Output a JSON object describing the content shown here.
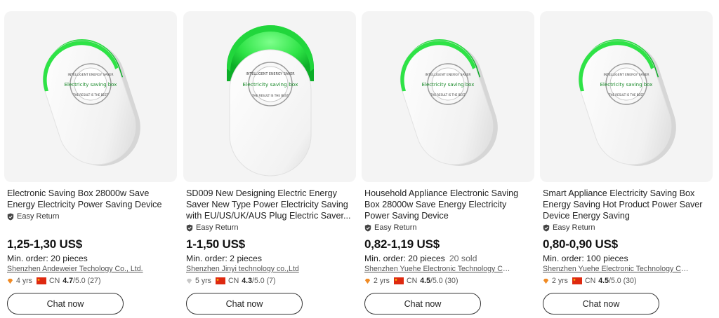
{
  "products": [
    {
      "title": "Electronic Saving Box 28000w Save Energy Electricity Power Saving Device",
      "easy_return": "Easy Return",
      "price": "1,25-1,30 US$",
      "min_order": "Min. order: 20 pieces",
      "sold": "",
      "supplier": "Shenzhen Andeweier Techology Co., Ltd.",
      "years": "4 yrs",
      "country": "CN",
      "rating_score": "4.7",
      "rating_rest": "/5.0 (27)",
      "chat_label": "Chat now",
      "badge_icon": "orange-diamond-icon",
      "device_label_top": "INTELLIGENT ENERGY SAVER",
      "device_label_main": "Electricity saving box",
      "device_label_bottom": "THE RESULT IS THE BEST"
    },
    {
      "title": "SD009 New Designing Electric Energy Saver New Type Power Electricity Saving with EU/US/UK/AUS Plug Electric Saver...",
      "easy_return": "Easy Return",
      "price": "1-1,50 US$",
      "min_order": "Min. order: 2 pieces",
      "sold": "",
      "supplier": "Shenzhen Jinyi technology co.,Ltd",
      "years": "5 yrs",
      "country": "CN",
      "rating_score": "4.3",
      "rating_rest": "/5.0 (7)",
      "chat_label": "Chat now",
      "badge_icon": "grey-diamond-icon",
      "device_label_top": "INTELLIGENT ENERGY SAVER",
      "device_label_main": "Electricity saving box",
      "device_label_bottom": "THE RESULT IS THE BEST"
    },
    {
      "title": "Household Appliance Electronic Saving Box 28000w Save Energy Electricity Power Saving Device",
      "easy_return": "Easy Return",
      "price": "0,82-1,19 US$",
      "min_order": "Min. order: 20 pieces",
      "sold": "20 sold",
      "supplier": "Shenzhen Yuehe Electronic Technology Co.,...",
      "years": "2 yrs",
      "country": "CN",
      "rating_score": "4.5",
      "rating_rest": "/5.0 (30)",
      "chat_label": "Chat now",
      "badge_icon": "orange-diamond-icon",
      "device_label_top": "INTELLIGENT ENERGY SAVER",
      "device_label_main": "Electricity saving box",
      "device_label_bottom": "THE RESULT IS THE BEST"
    },
    {
      "title": "Smart Appliance Electricity Saving Box Energy Saving Hot Product Power Saver Device Energy Saving",
      "easy_return": "Easy Return",
      "price": "0,80-0,90 US$",
      "min_order": "Min. order: 100 pieces",
      "sold": "",
      "supplier": "Shenzhen Yuehe Electronic Technology Co.,...",
      "years": "2 yrs",
      "country": "CN",
      "rating_score": "4.5",
      "rating_rest": "/5.0 (30)",
      "chat_label": "Chat now",
      "badge_icon": "orange-diamond-icon",
      "device_label_top": "INTELLIGENT ENERGY SAVER",
      "device_label_main": "Electricity saving box",
      "device_label_bottom": "THE RESULT IS THE BEST"
    }
  ],
  "colors": {
    "accent_green": "#27d83f",
    "badge_orange": "#f08a24",
    "badge_grey": "#c8c8c8",
    "flag_red": "#de2910",
    "flag_yellow": "#ffde00",
    "image_bg": "#f4f4f4"
  }
}
